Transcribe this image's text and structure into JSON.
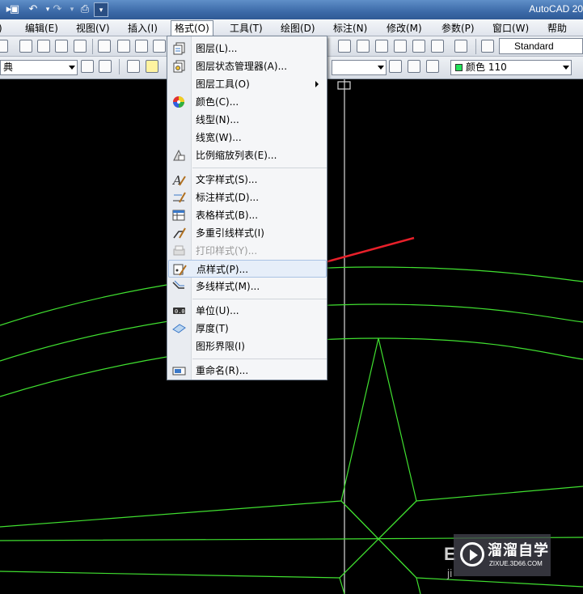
{
  "window": {
    "title": "AutoCAD 20"
  },
  "menubar": {
    "items": [
      {
        "label": "编辑(E)"
      },
      {
        "label": "视图(V)"
      },
      {
        "label": "插入(I)"
      },
      {
        "label": "格式(O)"
      },
      {
        "label": "工具(T)"
      },
      {
        "label": "绘图(D)"
      },
      {
        "label": "标注(N)"
      },
      {
        "label": "修改(M)"
      },
      {
        "label": "参数(P)"
      },
      {
        "label": "窗口(W)"
      },
      {
        "label": "帮助(H)"
      }
    ]
  },
  "toolbar": {
    "text_style": "Standard",
    "layer_value": "典",
    "color_value": "颜色 110",
    "color_swatch": "#22e35a"
  },
  "format_menu": {
    "items": [
      {
        "label": "图层(L)...",
        "icon": "layers-icon"
      },
      {
        "label": "图层状态管理器(A)...",
        "icon": "layer-state-icon"
      },
      {
        "label": "图层工具(O)",
        "icon": "",
        "submenu": true
      },
      {
        "label": "颜色(C)...",
        "icon": "color-wheel-icon"
      },
      {
        "label": "线型(N)...",
        "icon": ""
      },
      {
        "label": "线宽(W)...",
        "icon": ""
      },
      {
        "label": "比例缩放列表(E)...",
        "icon": "scale-list-icon"
      },
      {
        "label": "文字样式(S)...",
        "icon": "text-style-icon"
      },
      {
        "label": "标注样式(D)...",
        "icon": "dim-style-icon"
      },
      {
        "label": "表格样式(B)...",
        "icon": "table-style-icon"
      },
      {
        "label": "多重引线样式(I)",
        "icon": "mleader-style-icon"
      },
      {
        "label": "打印样式(Y)...",
        "icon": "plot-style-icon",
        "disabled": true
      },
      {
        "label": "点样式(P)...",
        "icon": "point-style-icon",
        "highlighted": true
      },
      {
        "label": "多线样式(M)...",
        "icon": "mline-style-icon"
      },
      {
        "label": "单位(U)...",
        "icon": "units-icon"
      },
      {
        "label": "厚度(T)",
        "icon": "thickness-icon"
      },
      {
        "label": "图形界限(I)",
        "icon": ""
      },
      {
        "label": "重命名(R)...",
        "icon": "rename-icon"
      }
    ]
  },
  "annotation": {
    "arrow_color": "#e8202a"
  },
  "drawing": {
    "line_color": "#40e030"
  },
  "watermark": {
    "text": "溜溜自学",
    "sub": "ZIXUE.3D66.COM"
  }
}
